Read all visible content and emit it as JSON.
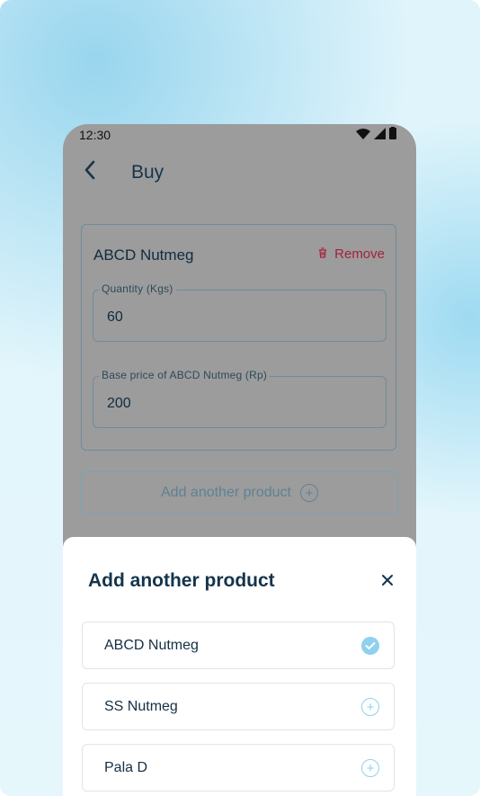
{
  "status_bar": {
    "time": "12:30",
    "icons": [
      "wifi-icon",
      "signal-icon",
      "battery-icon"
    ]
  },
  "app_bar": {
    "back_icon": "chevron-left-icon",
    "title": "Buy"
  },
  "product_card": {
    "name": "ABCD Nutmeg",
    "remove_label": "Remove",
    "remove_icon": "trash-icon",
    "fields": [
      {
        "label": "Quantity (Kgs)",
        "value": "60"
      },
      {
        "label": "Base price of ABCD Nutmeg (Rp)",
        "value": "200"
      }
    ]
  },
  "add_another_button": {
    "label": "Add another product",
    "icon": "circle-plus-icon"
  },
  "sheet": {
    "title": "Add another product",
    "close_icon": "close-icon",
    "options": [
      {
        "label": "ABCD Nutmeg",
        "state": "selected"
      },
      {
        "label": "SS Nutmeg",
        "state": "add"
      },
      {
        "label": "Pala D",
        "state": "add"
      }
    ]
  },
  "colors": {
    "accent": "#8fd0ef",
    "danger": "#a4213a",
    "title": "#15344c",
    "overlay": "#9c9c9c"
  }
}
